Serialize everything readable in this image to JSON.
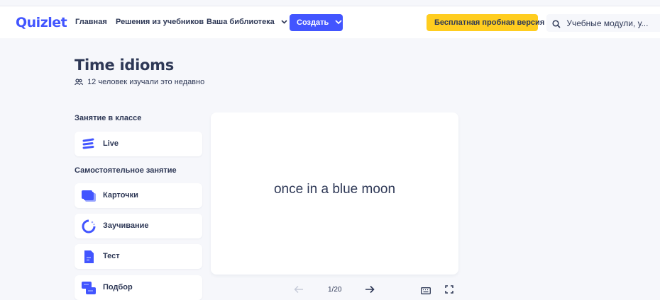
{
  "header": {
    "logo": "Quizlet",
    "nav": [
      {
        "label": "Главная"
      },
      {
        "label": "Решения из учебников"
      },
      {
        "label": "Ваша библиотека"
      }
    ],
    "create_label": "Создать",
    "trial_label": "Бесплатная пробная версия",
    "search_placeholder": "Учебные модули, у..."
  },
  "set": {
    "title": "Time idioms",
    "learners": "12 человек изучали это недавно"
  },
  "sections": {
    "classroom": "Занятие в классе",
    "self_study": "Самостоятельное занятие"
  },
  "modes": {
    "live": "Live",
    "cards": "Карточки",
    "learn": "Заучивание",
    "test": "Тест",
    "match": "Подбор"
  },
  "flashcard": {
    "term": "once in a blue moon",
    "counter": "1/20"
  },
  "colors": {
    "brand": "#4255ff",
    "trial": "#ffcd1f",
    "text": "#2e3856",
    "background": "#f6f7fb"
  }
}
